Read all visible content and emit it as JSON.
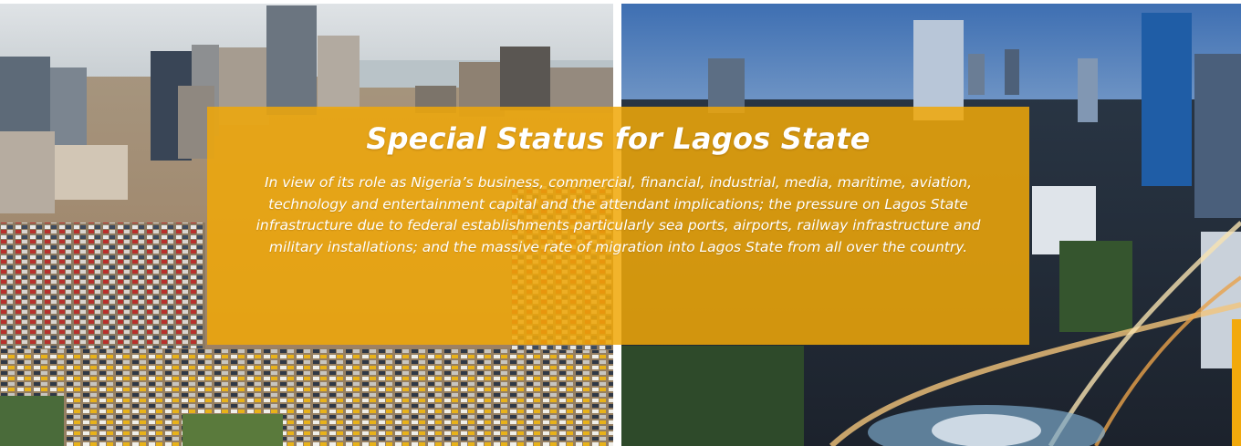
{
  "banner": {
    "title": "Special Status for Lagos State",
    "body": "In view of its role as Nigeria’s business, commercial, financial, industrial, media, maritime, aviation, technology and entertainment capital and the attendant implications; the pressure on Lagos State infrastructure due to federal establishments particularly sea ports, airports, railway infrastructure and military installations; and the massive rate of migration into Lagos State from all over the country."
  },
  "colors": {
    "banner_overlay": "#F0A808",
    "text": "#FFFFFF"
  }
}
